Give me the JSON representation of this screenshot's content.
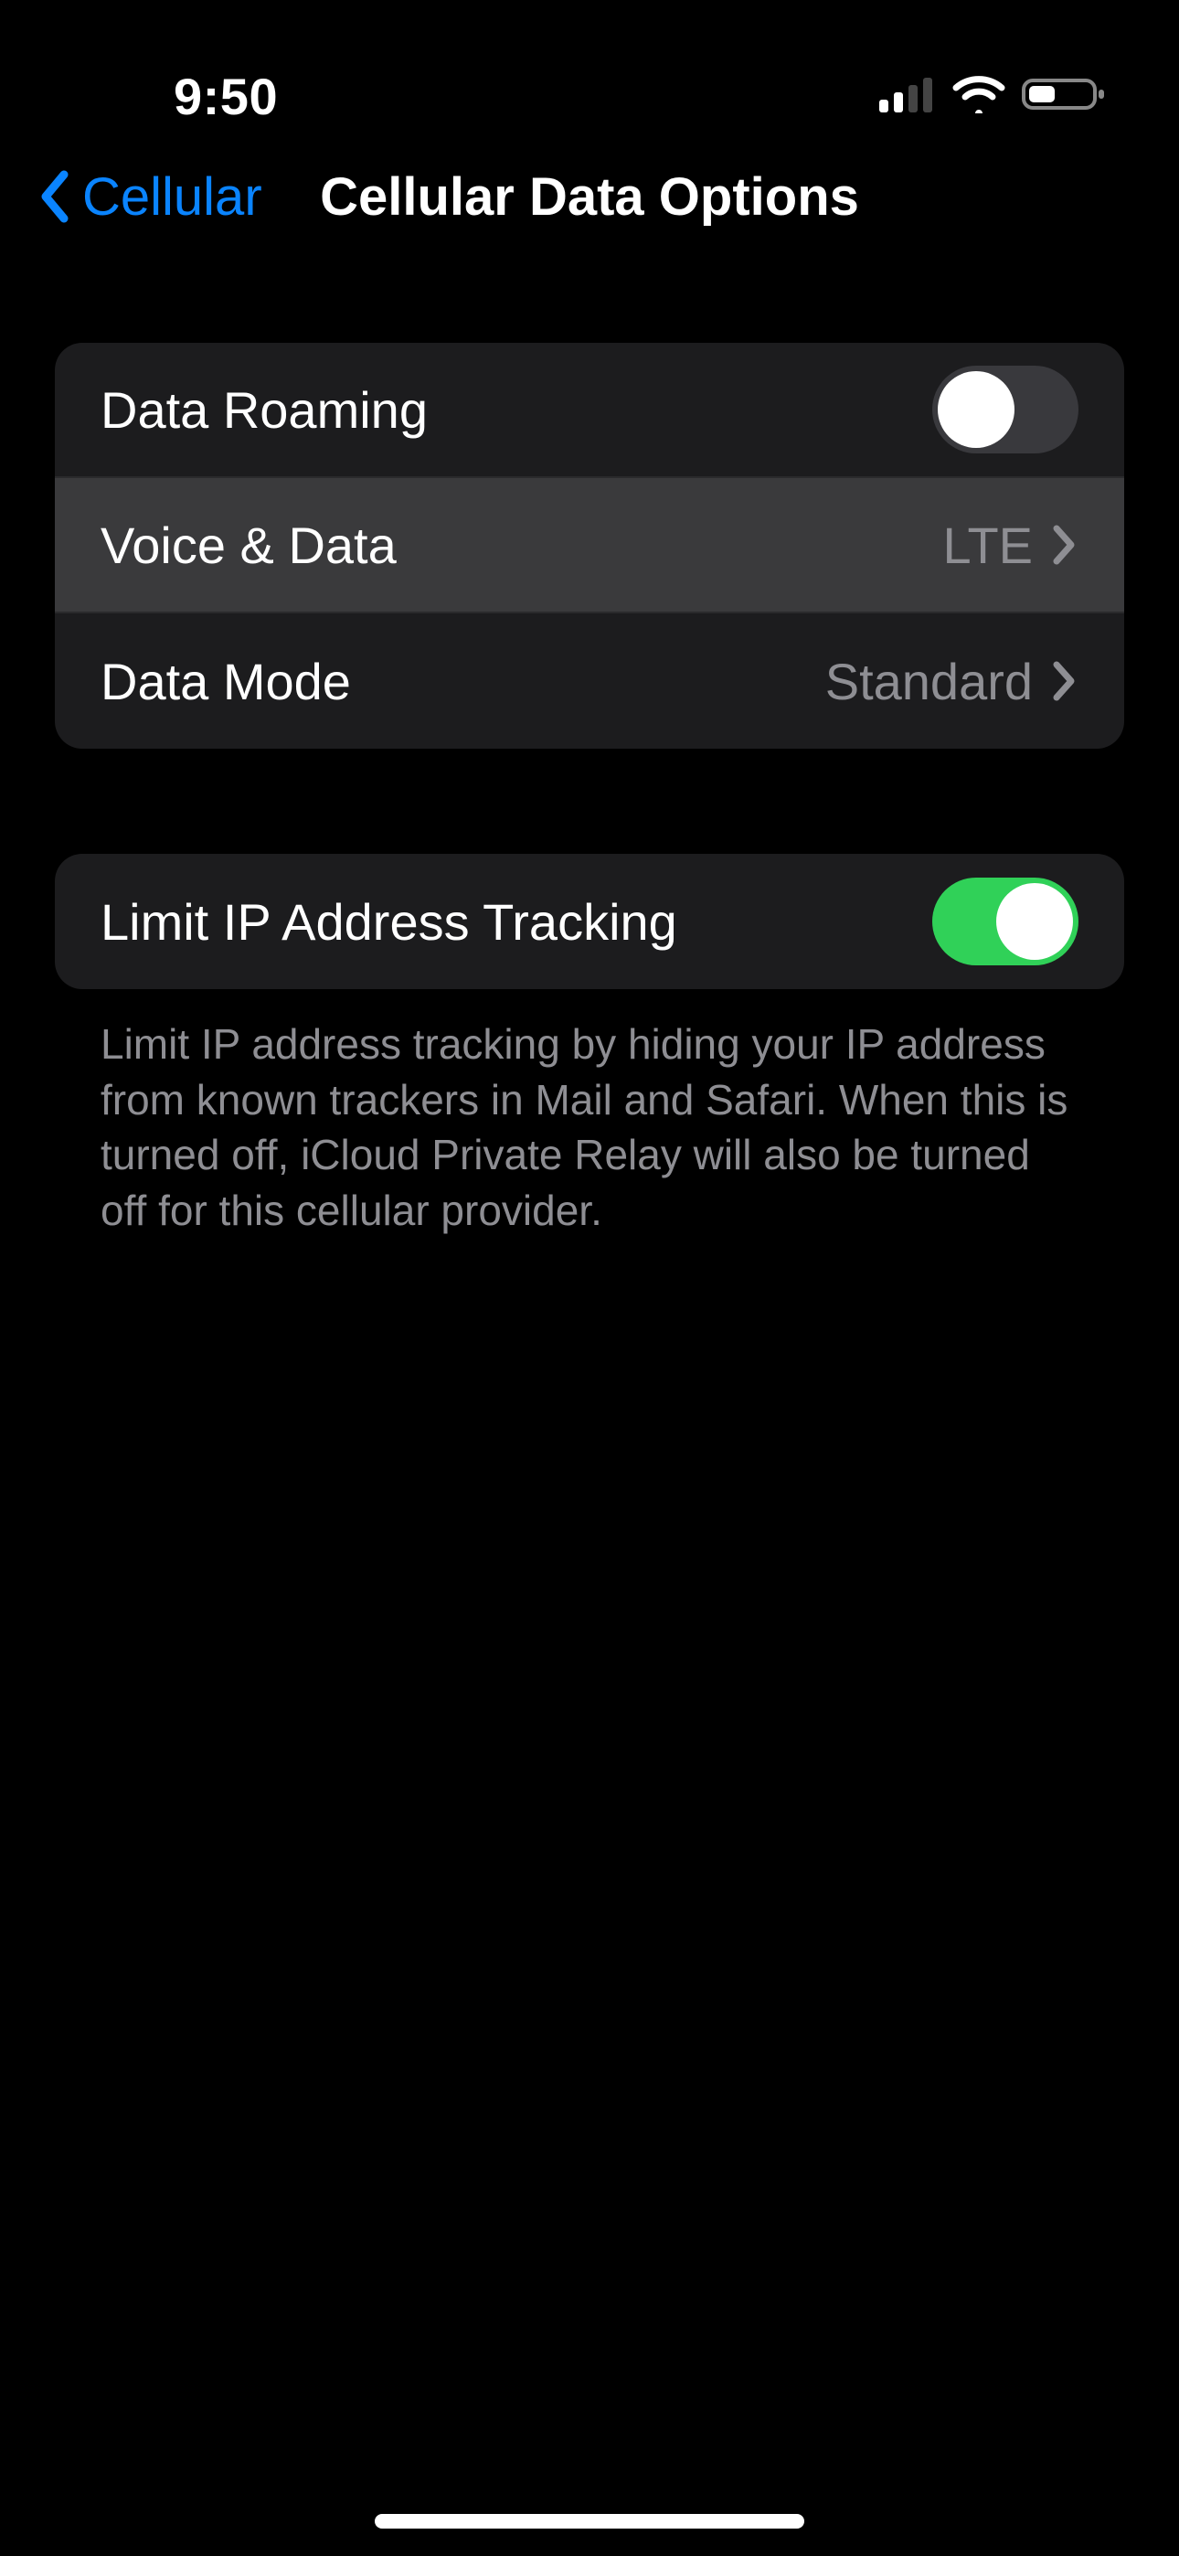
{
  "status": {
    "time": "9:50"
  },
  "nav": {
    "back_label": "Cellular",
    "title": "Cellular Data Options"
  },
  "group1": {
    "data_roaming": {
      "label": "Data Roaming",
      "on": false
    },
    "voice_data": {
      "label": "Voice & Data",
      "value": "LTE"
    },
    "data_mode": {
      "label": "Data Mode",
      "value": "Standard"
    }
  },
  "group2": {
    "limit_ip": {
      "label": "Limit IP Address Tracking",
      "on": true
    },
    "footer": "Limit IP address tracking by hiding your IP address from known trackers in Mail and Safari. When this is turned off, iCloud Private Relay will also be turned off for this cellular provider."
  },
  "colors": {
    "accent": "#0a84ff",
    "toggle_on": "#30d158"
  }
}
